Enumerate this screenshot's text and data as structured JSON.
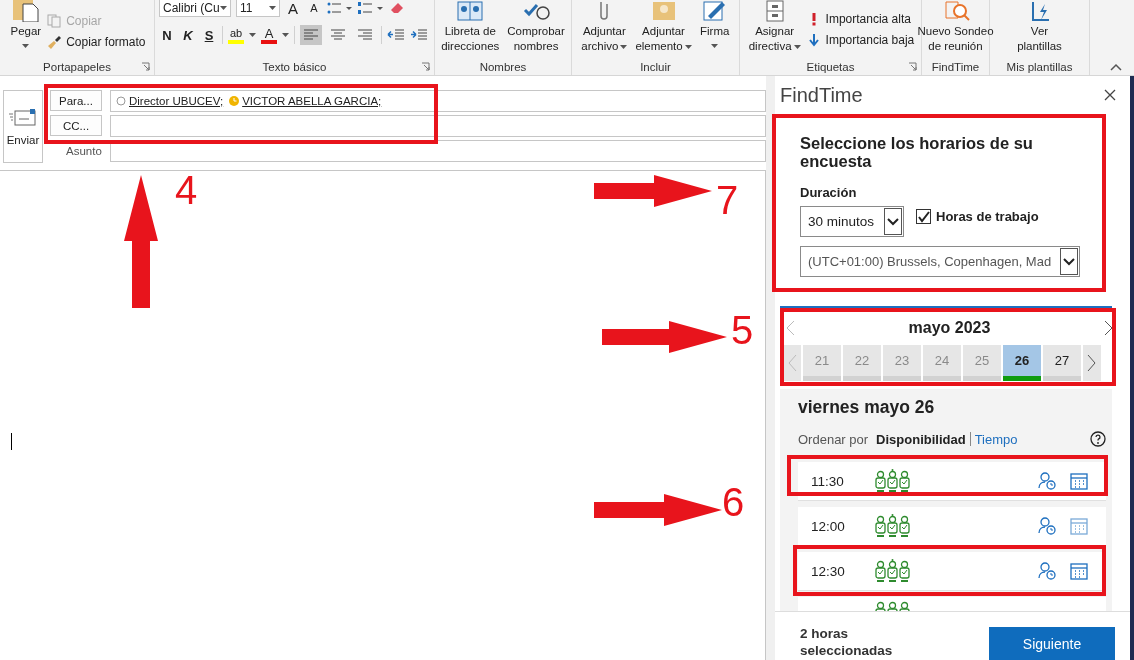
{
  "ribbon": {
    "groups": [
      {
        "kind": "clipboard",
        "label": "Portapapeles",
        "launcher": true,
        "paste": "Pegar",
        "copy": {
          "label": "Copiar",
          "disabled": true
        },
        "format_painter": {
          "label": "Copiar formato",
          "disabled": false
        }
      },
      {
        "kind": "text",
        "label": "Texto básico",
        "launcher": true,
        "font": "Calibri (Cu",
        "size": "11",
        "grow": "A",
        "shrink": "A",
        "bold": "N",
        "italic": "K",
        "underline": "S",
        "highlight": "ab",
        "font_color": "A",
        "align": [
          {
            "kind": "left",
            "selected": true
          },
          {
            "kind": "center",
            "selected": false
          },
          {
            "kind": "right",
            "selected": false
          }
        ]
      },
      {
        "kind": "large",
        "label": "Nombres",
        "buttons": [
          {
            "kind": "address-book",
            "lines": [
              "Libreta de",
              "direcciones"
            ],
            "dropdown": false
          },
          {
            "kind": "check-names",
            "lines": [
              "Comprobar",
              "nombres"
            ],
            "dropdown": false
          }
        ]
      },
      {
        "kind": "large",
        "label": "Incluir",
        "buttons": [
          {
            "kind": "paperclip",
            "lines": [
              "Adjuntar",
              "archivo"
            ],
            "dropdown": true
          },
          {
            "kind": "envelope",
            "lines": [
              "Adjuntar",
              "elemento"
            ],
            "dropdown": true
          },
          {
            "kind": "signature",
            "lines": [
              "Firma"
            ],
            "dropdown": true
          }
        ]
      },
      {
        "kind": "large",
        "label": "Etiquetas",
        "launcher": true,
        "buttons": [
          {
            "kind": "cabinet",
            "lines": [
              "Asignar",
              "directiva"
            ],
            "dropdown": true
          }
        ],
        "small": [
          {
            "kind": "high",
            "label": "Importancia alta"
          },
          {
            "kind": "low",
            "label": "Importancia baja"
          }
        ]
      },
      {
        "kind": "large",
        "label": "FindTime",
        "buttons": [
          {
            "kind": "poll",
            "lines": [
              "Nuevo Sondeo",
              "de reunión"
            ],
            "dropdown": false
          }
        ]
      },
      {
        "kind": "large",
        "label": "Mis plantillas",
        "buttons": [
          {
            "kind": "templates",
            "lines": [
              "Ver",
              "plantillas"
            ],
            "dropdown": false
          }
        ]
      }
    ]
  },
  "compose": {
    "send": "Enviar",
    "to_button": "Para...",
    "recipients": [
      {
        "name": "Director UBUCEV;",
        "kind": "unknown"
      },
      {
        "name": "VICTOR ABELLA GARCIA;",
        "kind": "away"
      }
    ],
    "cc_button": "CC...",
    "subject_label": "Asunto"
  },
  "findtime": {
    "title": "FindTime",
    "heading": "Seleccione los horarios de su encuesta",
    "duration_label": "Duración",
    "duration": "30 minutos",
    "working_hours": {
      "label": "Horas de trabajo",
      "checked": true
    },
    "timezone": "(UTC+01:00) Brussels, Copenhagen, Mad",
    "month": "mayo 2023",
    "days": [
      {
        "day": "21",
        "disabled": true,
        "selected": false
      },
      {
        "day": "22",
        "disabled": true,
        "selected": false
      },
      {
        "day": "23",
        "disabled": true,
        "selected": false
      },
      {
        "day": "24",
        "disabled": true,
        "selected": false
      },
      {
        "day": "25",
        "disabled": true,
        "selected": false
      },
      {
        "day": "26",
        "disabled": false,
        "selected": true
      },
      {
        "day": "27",
        "disabled": false,
        "selected": false
      }
    ],
    "day_title": "viernes mayo 26",
    "sort_label": "Ordenar por",
    "sort_options": [
      {
        "label": "Disponibilidad",
        "selected": true
      },
      {
        "label": "Tiempo",
        "selected": false
      }
    ],
    "slots": [
      {
        "time": "11:30",
        "selected": true,
        "attendees": [
          {
            "kind": "attendee"
          },
          {
            "kind": "organizer"
          },
          {
            "kind": "attendee"
          }
        ]
      },
      {
        "time": "12:00",
        "selected": false,
        "attendees": [
          {
            "kind": "attendee"
          },
          {
            "kind": "organizer"
          },
          {
            "kind": "attendee"
          }
        ]
      },
      {
        "time": "12:30",
        "selected": true,
        "attendees": [
          {
            "kind": "attendee"
          },
          {
            "kind": "organizer"
          },
          {
            "kind": "attendee"
          }
        ]
      }
    ],
    "partial_slot": true,
    "selection_summary": "2 horas seleccionadas",
    "next_button": "Siguiente"
  },
  "annotations": [
    {
      "number": "4",
      "kind": "up"
    },
    {
      "number": "7",
      "kind": "right"
    },
    {
      "number": "5",
      "kind": "right"
    },
    {
      "number": "6",
      "kind": "right"
    }
  ]
}
